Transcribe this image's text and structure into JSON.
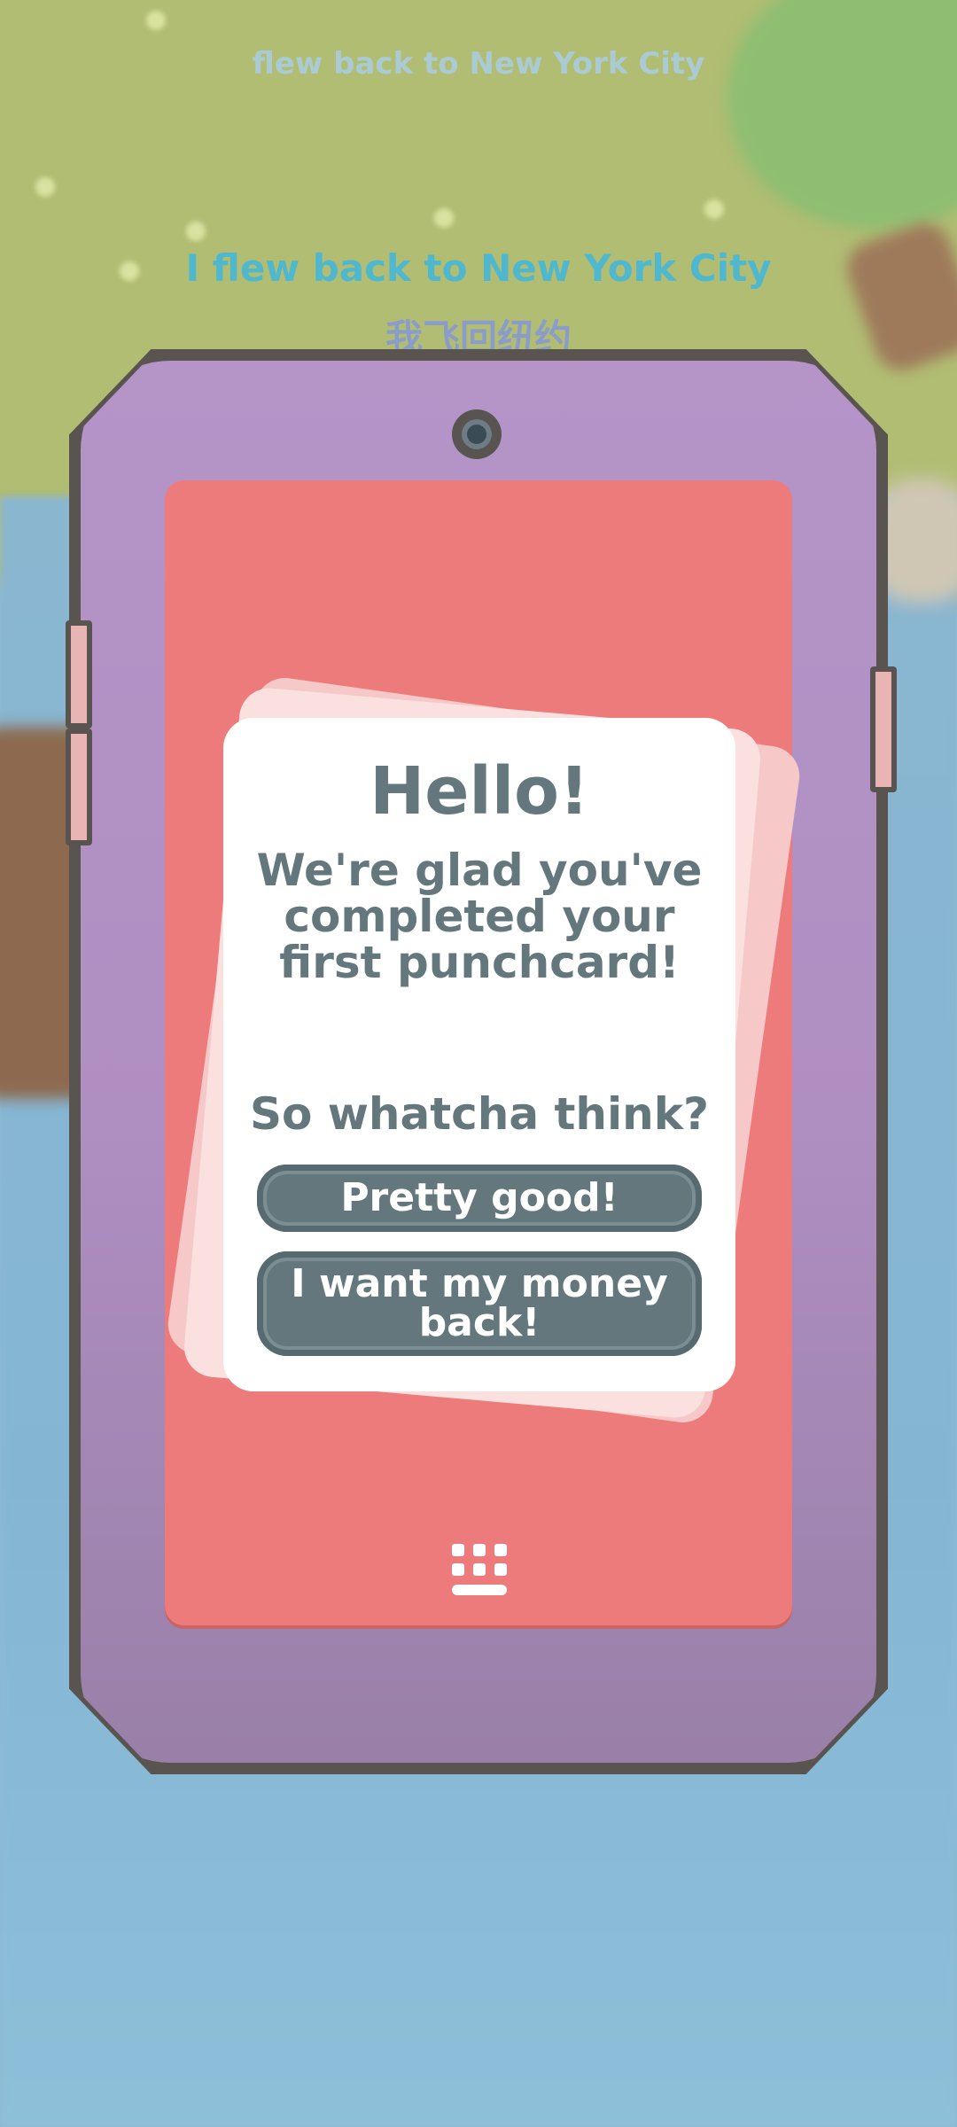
{
  "subtitles": {
    "faded_en": "flew back to New York City",
    "en": "I flew back to New York City",
    "zh": "我飞回纽约"
  },
  "dialog": {
    "greeting": "Hello!",
    "message": "We're glad you've completed your first punchcard!",
    "question": "So whatcha think?",
    "option_positive": "Pretty good!",
    "option_negative": "I want my money back!"
  },
  "icons": {
    "keyboard": "keyboard-icon",
    "camera": "camera-icon"
  },
  "colors": {
    "phone_body": "#b595c8",
    "screen": "#ee7b7b",
    "card": "#ffffff",
    "text": "#63777c",
    "button": "#63777c",
    "subtitle_en": "#4fb8cf",
    "subtitle_zh": "#8b9cc8"
  }
}
